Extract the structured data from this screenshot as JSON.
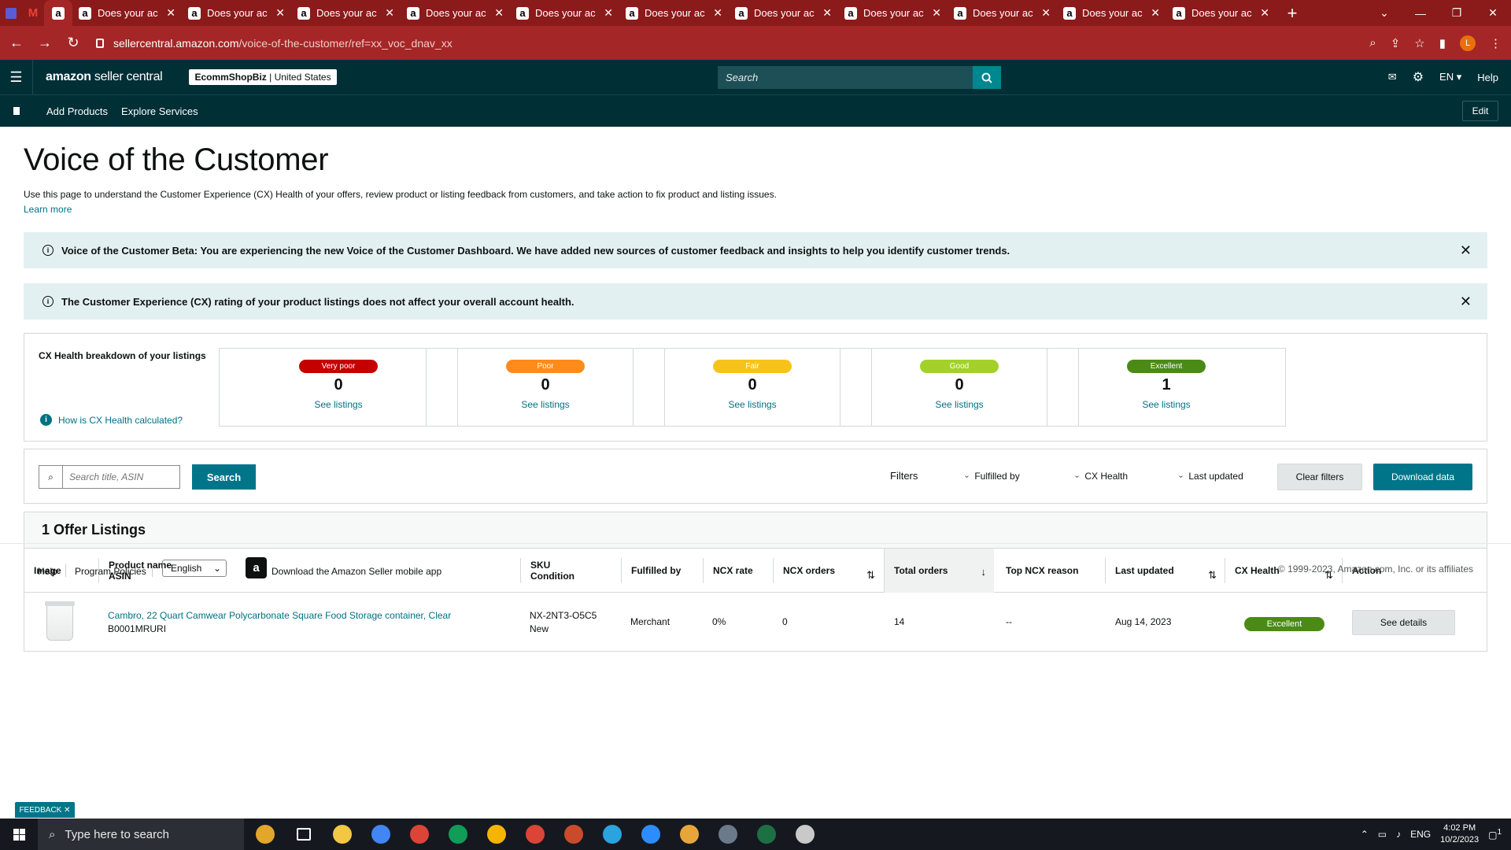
{
  "browser": {
    "tabs": [
      {
        "title": "Does your ac"
      },
      {
        "title": "Does your ac"
      },
      {
        "title": "Does your ac"
      },
      {
        "title": "Does your ac"
      },
      {
        "title": "Does your ac"
      },
      {
        "title": "Does your ac"
      },
      {
        "title": "Does your ac"
      },
      {
        "title": "Does your ac"
      },
      {
        "title": "Does your ac"
      },
      {
        "title": "Does your ac"
      },
      {
        "title": "Does your ac"
      }
    ],
    "url_host": "sellercentral.amazon.com",
    "url_path": "/voice-of-the-customer/ref=xx_voc_dnav_xx",
    "profile_initial": "L",
    "accent_color": "#a52626"
  },
  "header": {
    "logo_bold": "amazon",
    "logo_rest": " seller central",
    "store_name": "EcommShopBiz",
    "store_region": " | United States",
    "search_placeholder": "Search",
    "language": "EN",
    "help": "Help"
  },
  "subnav": {
    "items": [
      "Add Products",
      "Explore Services"
    ],
    "edit": "Edit"
  },
  "page": {
    "title": "Voice of the Customer",
    "description": "Use this page to understand the Customer Experience (CX) Health of your offers, review product or listing feedback from customers, and take action to fix product and listing issues.",
    "learn_more": "Learn more",
    "banner_beta": "Voice of the Customer Beta: You are experiencing the new Voice of the Customer Dashboard. We have added new sources of customer feedback and insights to help you identify customer trends.",
    "banner_rating": "The Customer Experience (CX) rating of your product listings does not affect your overall account health."
  },
  "cx_health": {
    "title": "CX Health breakdown of your listings",
    "how_link": "How is CX Health calculated?",
    "tiles": [
      {
        "label": "Very poor",
        "count": "0",
        "link": "See listings",
        "color": "#c40000"
      },
      {
        "label": "Poor",
        "count": "0",
        "link": "See listings",
        "color": "#ff8c1a"
      },
      {
        "label": "Fair",
        "count": "0",
        "link": "See listings",
        "color": "#f7c31a"
      },
      {
        "label": "Good",
        "count": "0",
        "link": "See listings",
        "color": "#a3d12a"
      },
      {
        "label": "Excellent",
        "count": "1",
        "link": "See listings",
        "color": "#4b8a15"
      }
    ]
  },
  "filters": {
    "search_placeholder": "Search title, ASIN",
    "search_button": "Search",
    "label": "Filters",
    "fulfilled_by": "Fulfilled by",
    "cx_health": "CX Health",
    "last_updated": "Last updated",
    "clear": "Clear filters",
    "download": "Download data"
  },
  "listings": {
    "heading": "1 Offer Listings",
    "columns": {
      "image": "Image",
      "product_name": "Product name",
      "asin": "ASIN",
      "sku": "SKU",
      "condition": "Condition",
      "fulfilled_by": "Fulfilled by",
      "ncx_rate": "NCX rate",
      "ncx_orders": "NCX orders",
      "total_orders": "Total orders",
      "top_ncx_reason": "Top NCX reason",
      "last_updated": "Last updated",
      "cx_health": "CX Health",
      "action": "Action"
    },
    "rows": [
      {
        "product_name": "Cambro, 22 Quart Camwear Polycarbonate Square Food Storage container, Clear",
        "asin": "B0001MRURI",
        "sku": "NX-2NT3-O5C5",
        "condition": "New",
        "fulfilled_by": "Merchant",
        "ncx_rate": "0%",
        "ncx_orders": "0",
        "total_orders": "14",
        "top_ncx_reason": "--",
        "last_updated": "Aug 14, 2023",
        "cx_health": "Excellent",
        "action": "See details"
      }
    ]
  },
  "footer": {
    "help": "Help",
    "program_policies": "Program Policies",
    "language": "English",
    "app_link": "Download the Amazon Seller mobile app",
    "copyright": "© 1999-2023, Amazon.com, Inc. or its affiliates",
    "feedback": "FEEDBACK"
  },
  "taskbar": {
    "search_placeholder": "Type here to search",
    "lang": "ENG",
    "time": "4:02 PM",
    "date": "10/2/2023",
    "notifications": "1"
  }
}
